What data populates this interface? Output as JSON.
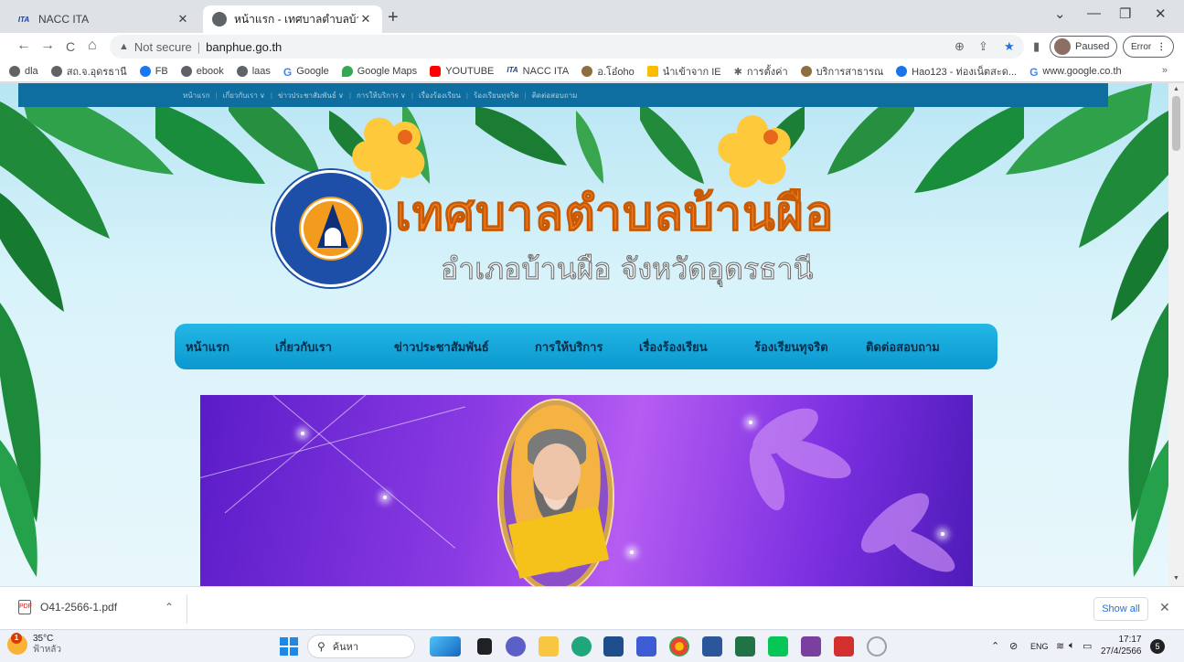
{
  "browser": {
    "tabs": [
      {
        "label": "NACC ITA",
        "icon": "nacc-icon"
      },
      {
        "label": "หน้าแรก - เทศบาลตำบลบ้านผือ อำเภอ",
        "icon": "globe-icon"
      }
    ],
    "window_controls": {
      "collapse": "⌄",
      "minimize": "—",
      "restore": "❐",
      "close": "✕"
    },
    "nav": {
      "back": "←",
      "forward": "→",
      "reload": "C",
      "home": "⌂"
    },
    "address": {
      "security_label": "Not secure",
      "url": "banphue.go.th"
    },
    "profile": {
      "status_label": "Paused"
    },
    "error_button": {
      "label": "Error",
      "menu": "⋮"
    }
  },
  "bookmarks": [
    {
      "label": "dla",
      "icon": "globe-icon"
    },
    {
      "label": "สถ.จ.อุดรธานี",
      "icon": "globe-icon"
    },
    {
      "label": "FB",
      "icon": "facebook-icon"
    },
    {
      "label": "ebook",
      "icon": "globe-icon"
    },
    {
      "label": "laas",
      "icon": "globe-icon"
    },
    {
      "label": "Google",
      "icon": "google-icon"
    },
    {
      "label": "Google Maps",
      "icon": "maps-icon"
    },
    {
      "label": "YOUTUBE",
      "icon": "youtube-icon"
    },
    {
      "label": "NACC ITA",
      "icon": "nacc-icon"
    },
    {
      "label": "อ.โอ๋oho",
      "icon": "globe-icon"
    },
    {
      "label": "นำเข้าจาก IE",
      "icon": "folder-icon"
    },
    {
      "label": "การตั้งค่า",
      "icon": "gear-icon"
    },
    {
      "label": "บริการสาธารณ",
      "icon": "globe-icon"
    },
    {
      "label": "Hao123 - ท่องเน็ตสะด...",
      "icon": "hao-icon"
    },
    {
      "label": "www.google.co.th",
      "icon": "google-icon"
    }
  ],
  "bookmarks_overflow": "»",
  "site": {
    "top_nav": [
      "หน้าแรก",
      "เกี่ยวกับเรา ∨",
      "ข่าวประชาสัมพันธ์ ∨",
      "การให้บริการ ∨",
      "เรื่องร้องเรียน",
      "ร้องเรียนทุจริต",
      "ติดต่อสอบถาม"
    ],
    "title": "เทศบาลตำบลบ้านผือ",
    "subtitle": "อำเภอบ้านผือ จังหวัดอุดรธานี",
    "seal_text": "เทศบาลตำบลบ้านผือ จังหวัดอุดรธานี",
    "main_nav": [
      "หน้าแรก",
      "เกี่ยวกับเรา",
      "ข่าวประชาสัมพันธ์",
      "การให้บริการ",
      "เรื่องร้องเรียน",
      "ร้องเรียนทุจริต",
      "ติดต่อสอบถาม"
    ]
  },
  "download_bar": {
    "file_name": "O41-2566-1.pdf",
    "show_all_label": "Show all",
    "close": "✕"
  },
  "taskbar": {
    "weather_temp": "35°C",
    "weather_desc": "ฟ้าหลัว",
    "weather_badge": "1",
    "search_placeholder": "ค้นหา",
    "lang": "ENG",
    "time": "17:17",
    "date": "27/4/2566",
    "notification_count": "5"
  },
  "colors": {
    "site_nav_bar": "#0e6ea0",
    "main_nav": "#0a98d0",
    "title_orange": "#f07a1c",
    "banner_purple": "#8a3ae3",
    "accent_blue": "#1a73e8"
  }
}
